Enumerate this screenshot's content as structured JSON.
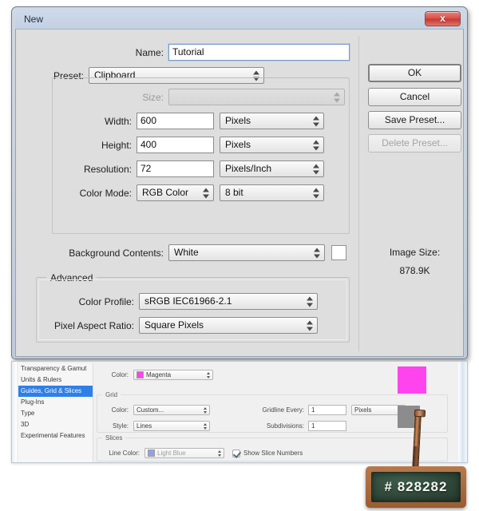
{
  "dialog": {
    "title": "New",
    "close_label": "x",
    "name_label": "Name:",
    "name_value": "Tutorial",
    "preset_label": "Preset:",
    "preset_value": "Clipboard",
    "size_label": "Size:",
    "size_value": "",
    "width_label": "Width:",
    "width_value": "600",
    "width_unit": "Pixels",
    "height_label": "Height:",
    "height_value": "400",
    "height_unit": "Pixels",
    "resolution_label": "Resolution:",
    "resolution_value": "72",
    "resolution_unit": "Pixels/Inch",
    "color_mode_label": "Color Mode:",
    "color_mode_value": "RGB Color",
    "color_depth_value": "8 bit",
    "background_label": "Background Contents:",
    "background_value": "White",
    "background_swatch": "#ffffff",
    "advanced_legend": "Advanced",
    "color_profile_label": "Color Profile:",
    "color_profile_value": "sRGB IEC61966-2.1",
    "pixel_aspect_label": "Pixel Aspect Ratio:",
    "pixel_aspect_value": "Square Pixels",
    "buttons": {
      "ok": "OK",
      "cancel": "Cancel",
      "save_preset": "Save Preset...",
      "delete_preset": "Delete Preset..."
    },
    "image_size_label": "Image Size:",
    "image_size_value": "878.9K"
  },
  "preferences": {
    "sidebar": [
      {
        "label": "Transparency & Gamut",
        "selected": false
      },
      {
        "label": "Units & Rulers",
        "selected": false
      },
      {
        "label": "Guides, Grid & Slices",
        "selected": true
      },
      {
        "label": "Plug-Ins",
        "selected": false
      },
      {
        "label": "Type",
        "selected": false
      },
      {
        "label": "3D",
        "selected": false
      },
      {
        "label": "Experimental Features",
        "selected": false
      }
    ],
    "guides": {
      "color_label": "Color:",
      "color_value": "Magenta",
      "color_swatch": "#ff44ee"
    },
    "grid": {
      "legend": "Grid",
      "color_label": "Color:",
      "color_value": "Custom...",
      "style_label": "Style:",
      "style_value": "Lines",
      "gridline_label": "Gridline Every:",
      "gridline_value": "1",
      "gridline_unit": "Pixels",
      "subdivisions_label": "Subdivisions:",
      "subdivisions_value": "1"
    },
    "slices": {
      "legend": "Slices",
      "line_color_label": "Line Color:",
      "line_color_value": "Light Blue",
      "line_color_swatch": "#8fa4e8",
      "show_numbers_label": "Show Slice Numbers",
      "show_numbers_checked": true
    }
  },
  "swatches": {
    "magenta": "#ff44ee",
    "gray": "#8c8c8c"
  },
  "callout": {
    "hex_text": "# 828282",
    "hex_value": "#828282"
  }
}
